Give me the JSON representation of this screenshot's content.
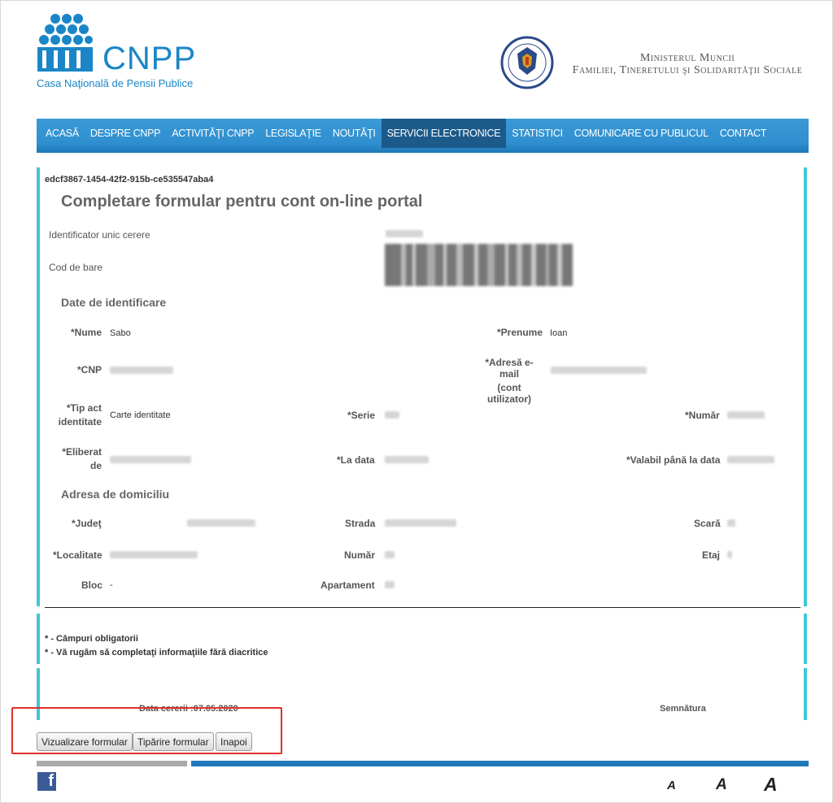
{
  "header": {
    "logo_text": "CNPP",
    "logo_subtitle": "Casa Naţională de Pensii Publice",
    "ministry_line1": "Ministerul Muncii",
    "ministry_line2": "Familiei, Tineretului şi Solidarităţii Sociale",
    "seal_icon": "guvernul-romaniei-seal-icon",
    "brand_color": "#1a86c7"
  },
  "nav": {
    "items": [
      "ACASĂ",
      "DESPRE CNPP",
      "ACTIVITĂŢI CNPP",
      "LEGISLAŢIE",
      "NOUTĂŢI",
      "SERVICII ELECTRONICE",
      "STATISTICI",
      "COMUNICARE CU PUBLICUL",
      "CONTACT"
    ],
    "active": "SERVICII ELECTRONICE",
    "bar_color": "#2f8fd0",
    "active_color": "#1c5a8a"
  },
  "form": {
    "guid": "edcf3867-1454-42f2-915b-ce535547aba4",
    "title": "Completare formular pentru cont on-line portal",
    "id_label": "Identificator unic cerere",
    "barcode_label": "Cod de bare",
    "section_identification": "Date de identificare",
    "nume_label": "*Nume",
    "nume_value": "Sabo",
    "prenume_label": "*Prenume",
    "prenume_value": "Ioan",
    "cnp_label": "*CNP",
    "email_label_1": "*Adresă e-mail",
    "email_label_2": "(cont utilizator)",
    "tip_act_label_1": "*Tip act",
    "tip_act_label_2": "identitate",
    "tip_act_value": "Carte identitate",
    "serie_label": "*Serie",
    "numar_label": "*Număr",
    "eliberat_label_1": "*Eliberat",
    "eliberat_label_2": "de",
    "la_data_label": "*La data",
    "valabil_label": "*Valabil până la data",
    "section_address": "Adresa de domiciliu",
    "judet_label": "*Judeţ",
    "strada_label": "Strada",
    "scara_label": "Scară",
    "localitate_label": "*Localitate",
    "numar_addr_label": "Număr",
    "etaj_label": "Etaj",
    "bloc_label": "Bloc",
    "bloc_value": "-",
    "apartament_label": "Apartament",
    "note_required": "* - Câmpuri obligatorii",
    "note_diacritics": "* - Vă rugăm să completaţi informaţiile fără diacritice",
    "date_label": "Data cererii :07.05.2020",
    "signature_label": "Semnătura",
    "accent_color": "#40c7d8"
  },
  "buttons": {
    "view": "Vizualizare formular",
    "print": "Tipărire formular",
    "back": "Inapoi",
    "highlight_color": "#e0302a"
  },
  "footer": {
    "facebook_icon": "facebook-icon",
    "font_small": "A",
    "font_medium": "A",
    "font_large": "A"
  }
}
